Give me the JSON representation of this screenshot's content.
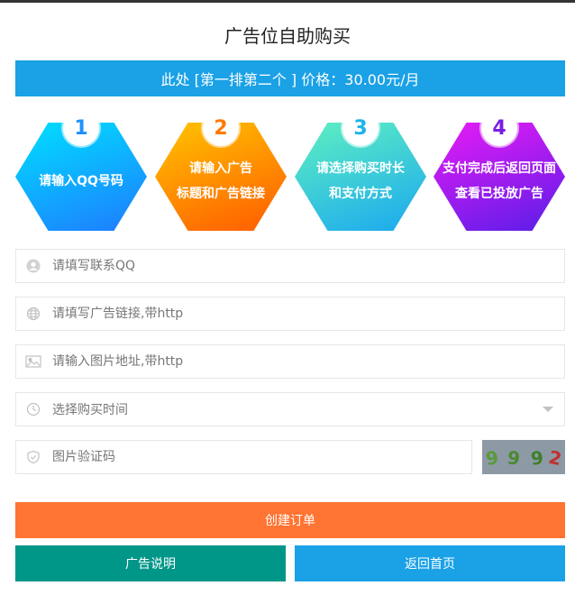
{
  "page": {
    "title": "广告位自助购买"
  },
  "banner": {
    "text": "此处 [第一排第二个 ] 价格：30.00元/月"
  },
  "steps": [
    {
      "number": "1",
      "line1": "请输入QQ号码",
      "line2": "",
      "color": "#1e90ff"
    },
    {
      "number": "2",
      "line1": "请输入广告",
      "line2": "标题和广告链接",
      "color": "#ff7a00"
    },
    {
      "number": "3",
      "line1": "请选择购买时长",
      "line2": "和支付方式",
      "color": "#1bb4e8"
    },
    {
      "number": "4",
      "line1": "支付完成后返回页面",
      "line2": "查看已投放广告",
      "color": "#7b1de0"
    }
  ],
  "form": {
    "qq": {
      "value": "",
      "placeholder": "请填写联系QQ"
    },
    "link": {
      "value": "",
      "placeholder": "请填写广告链接,带http"
    },
    "image": {
      "value": "",
      "placeholder": "请输入图片地址,带http"
    },
    "duration": {
      "selected": "选择购买时间"
    },
    "captcha": {
      "value": "",
      "placeholder": "图片验证码",
      "image_chars": [
        "9",
        "9",
        "9",
        "2"
      ]
    }
  },
  "buttons": {
    "create": "创建订单",
    "description": "广告说明",
    "home": "返回首页"
  }
}
